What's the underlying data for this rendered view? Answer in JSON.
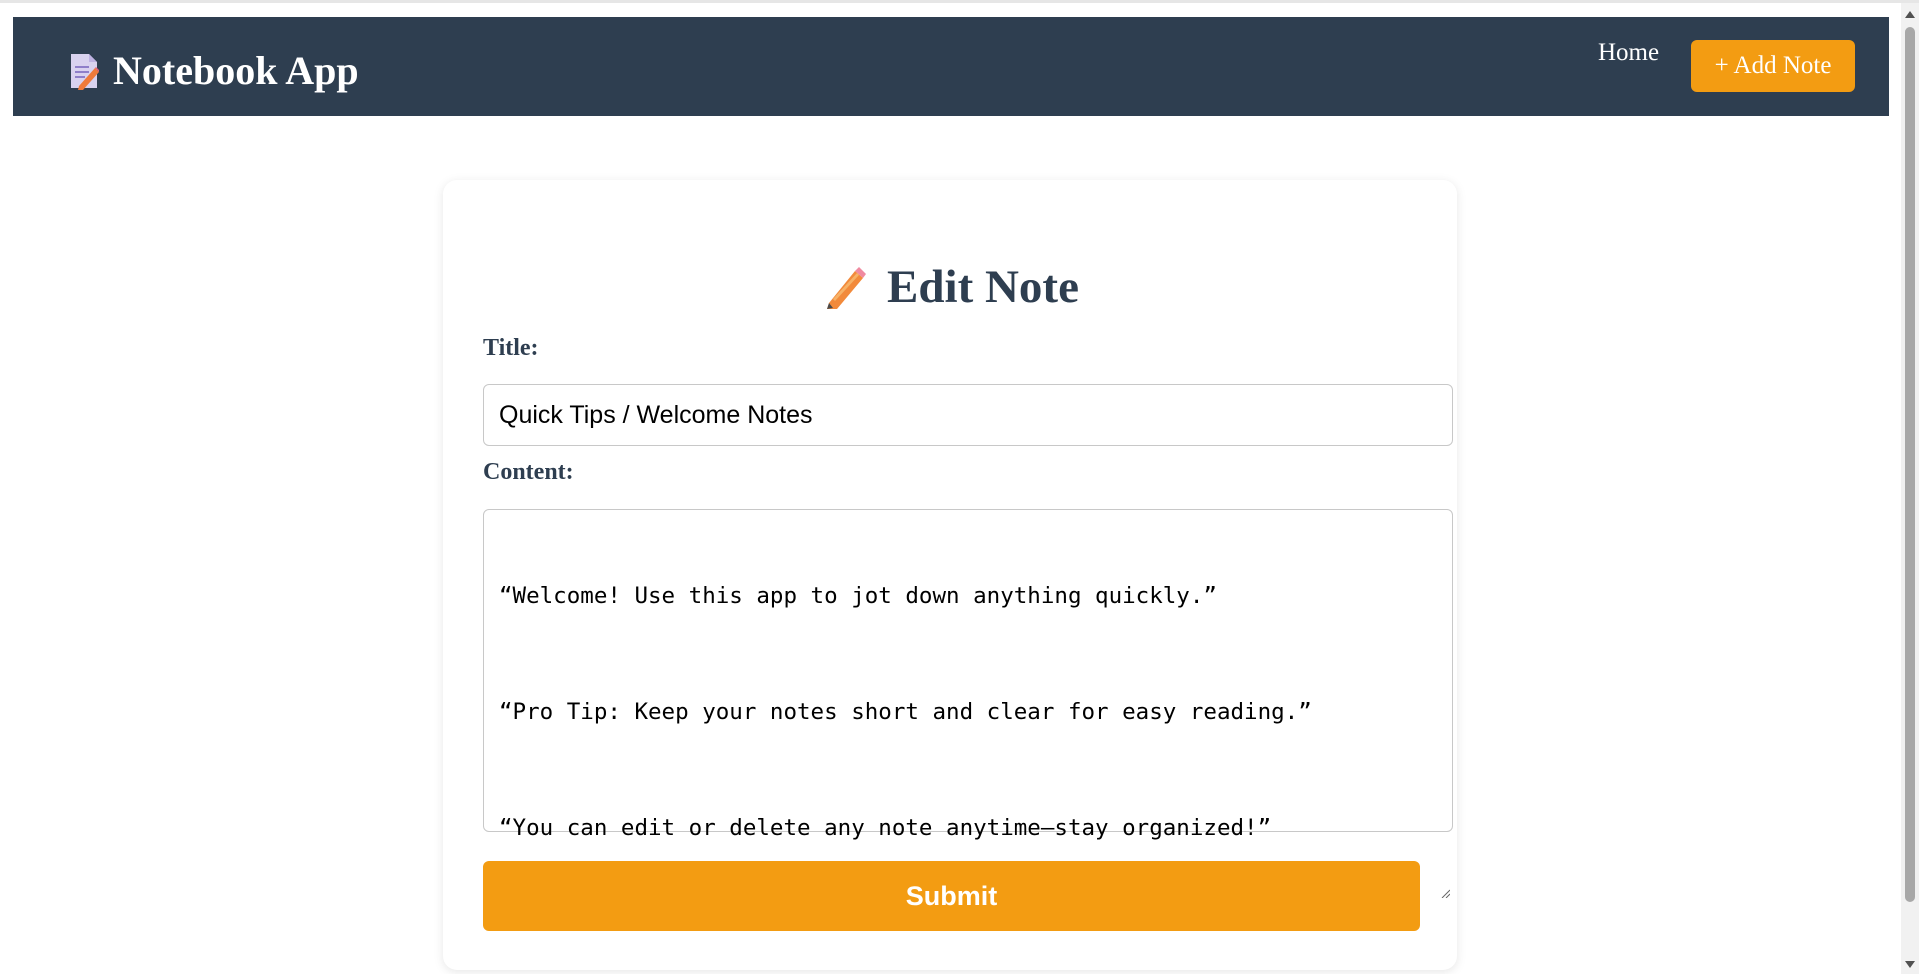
{
  "navbar": {
    "brand_icon": "memo-icon",
    "brand": "Notebook App",
    "home_label": "Home",
    "add_note_label": "+ Add Note",
    "background": "#2e3e50",
    "accent": "#f39c12"
  },
  "form": {
    "heading_icon": "pencil-icon",
    "heading": "Edit Note",
    "title_label": "Title:",
    "title_value": "Quick Tips / Welcome Notes",
    "content_label": "Content:",
    "content_lines": [
      "“Welcome! Use this app to jot down anything quickly.”",
      "“Pro Tip: Keep your notes short and clear for easy reading.”",
      "“You can edit or delete any note anytime—stay organized!”"
    ],
    "submit_label": "Submit"
  }
}
